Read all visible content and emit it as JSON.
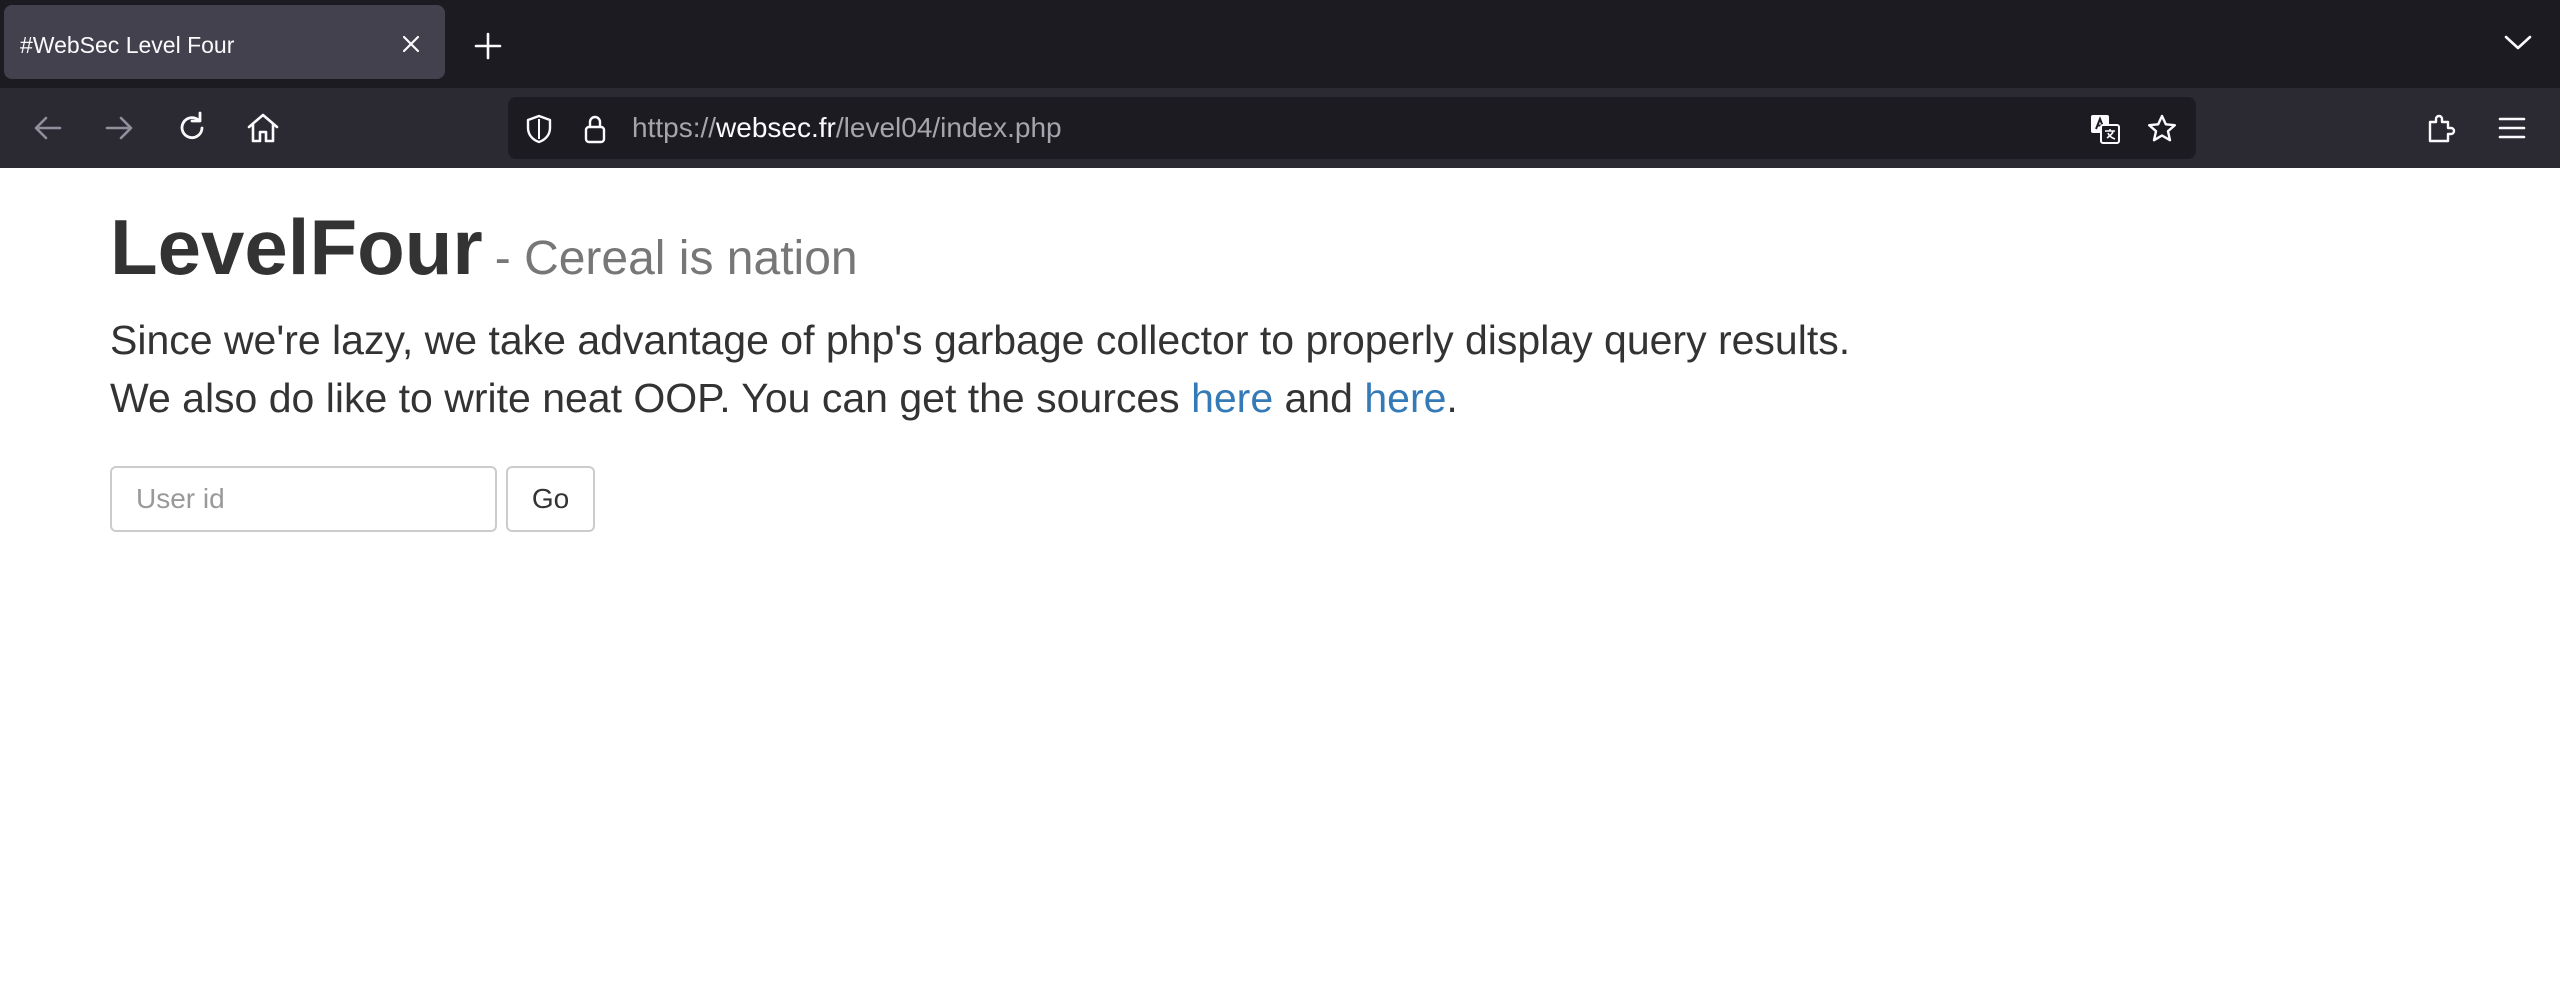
{
  "browser": {
    "tab": {
      "title": "#WebSec Level Four"
    },
    "url": {
      "scheme": "https://",
      "host": "websec.fr",
      "path": "/level04/index.php"
    }
  },
  "page": {
    "title": "LevelFour",
    "subtitle": "- Cereal is nation",
    "desc_line1": "Since we're lazy, we take advantage of php's garbage collector to properly display query results.",
    "desc_line2_prefix": "We also do like to write neat OOP. You can get the sources ",
    "link1": "here",
    "desc_and": " and ",
    "link2": "here",
    "desc_end": "."
  },
  "form": {
    "userid_placeholder": "User id",
    "userid_value": "",
    "go_label": "Go"
  }
}
